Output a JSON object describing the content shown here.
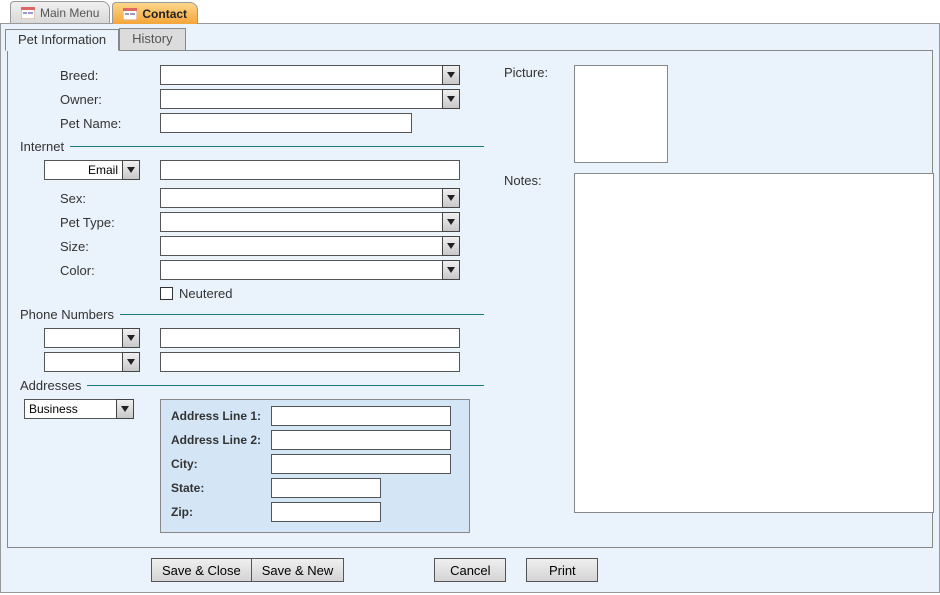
{
  "docTabs": {
    "mainMenu": "Main Menu",
    "contact": "Contact"
  },
  "innerTabs": {
    "petInfo": "Pet Information",
    "history": "History"
  },
  "labels": {
    "breed": "Breed:",
    "owner": "Owner:",
    "petName": "Pet Name:",
    "picture": "Picture:",
    "internet": "Internet",
    "emailType": "Email",
    "notes": "Notes:",
    "sex": "Sex:",
    "petType": "Pet Type:",
    "size": "Size:",
    "color": "Color:",
    "neutered": "Neutered",
    "phoneNumbers": "Phone Numbers",
    "addresses": "Addresses",
    "addressType": "Business",
    "addrLine1": "Address Line 1:",
    "addrLine2": "Address Line 2:",
    "city": "City:",
    "state": "State:",
    "zip": "Zip:"
  },
  "values": {
    "breed": "",
    "owner": "",
    "petName": "",
    "emailValue": "",
    "sex": "",
    "petType": "",
    "size": "",
    "color": "",
    "phone1Type": "",
    "phone1Value": "",
    "phone2Type": "",
    "phone2Value": "",
    "addrLine1": "",
    "addrLine2": "",
    "city": "",
    "state": "",
    "zip": "",
    "notes": ""
  },
  "buttons": {
    "saveClose": "Save & Close",
    "saveNew": "Save & New",
    "cancel": "Cancel",
    "print": "Print"
  }
}
